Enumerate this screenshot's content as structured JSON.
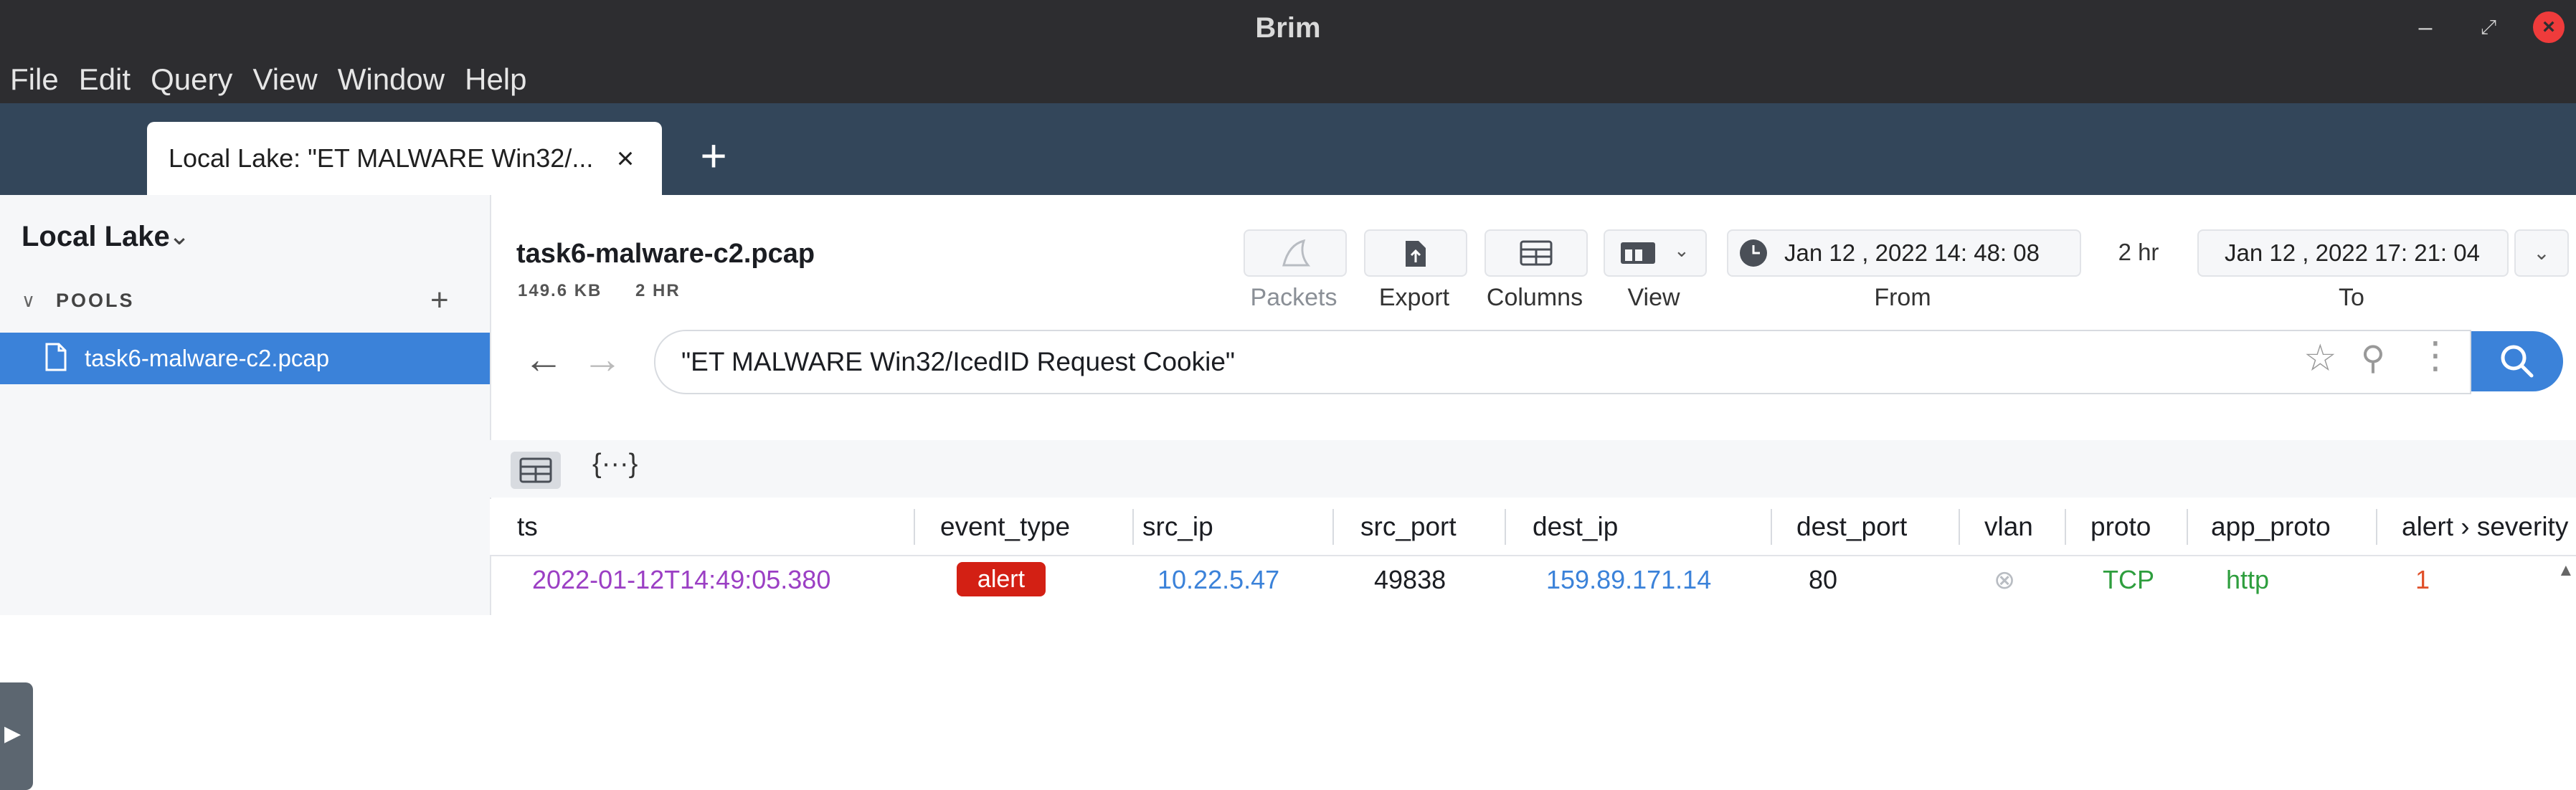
{
  "window": {
    "title": "Brim",
    "controls": {
      "minimize": "–",
      "restore": "⤢",
      "close": "×"
    }
  },
  "menu": [
    "File",
    "Edit",
    "Query",
    "View",
    "Window",
    "Help"
  ],
  "tabs": [
    {
      "label": "Local Lake: \"ET MALWARE Win32/...",
      "close_icon": "×",
      "active": true
    }
  ],
  "tab_add": "+",
  "sidebar": {
    "lake_name": "Local Lake",
    "lake_chevron": "⌄",
    "pools_chevron": "∨",
    "pools_label": "POOLS",
    "pools_add": "+",
    "pools": [
      {
        "name": "task6-malware-c2.pcap",
        "icon": "file-icon",
        "selected": true
      }
    ],
    "handle_icon": "▶"
  },
  "header": {
    "file_name": "task6-malware-c2.pcap",
    "file_size": "149.6 KB",
    "file_span": "2 HR",
    "buttons": {
      "packets": "Packets",
      "export": "Export",
      "columns": "Columns",
      "view": "View"
    },
    "time": {
      "from_value": "Jan  12 , 2022   14: 48: 08",
      "span": "2 hr",
      "to_value": "Jan  12 , 2022   17: 21: 04",
      "from_label": "From",
      "to_label": "To",
      "to_chevron": "⌄"
    }
  },
  "search": {
    "back_icon": "←",
    "forward_icon": "→",
    "query": "\"ET MALWARE Win32/IcedID Request Cookie\"",
    "star_icon": "☆",
    "pin_icon": "⚲",
    "more_icon": "⋮"
  },
  "results": {
    "json_view_icon": "{···}",
    "columns": [
      "ts",
      "event_type",
      "src_ip",
      "src_port",
      "dest_ip",
      "dest_port",
      "vlan",
      "proto",
      "app_proto",
      "alert › severity"
    ],
    "rows": [
      {
        "ts": "2022-01-12T14:49:05.380",
        "event_type": "alert",
        "src_ip": "10.22.5.47",
        "src_port": "49838",
        "dest_ip": "159.89.171.14",
        "dest_port": "80",
        "vlan": "⊗",
        "proto": "TCP",
        "app_proto": "http",
        "severity": "1"
      }
    ]
  },
  "colors": {
    "titlebar": "#2d2d30",
    "tabbar": "#33465a",
    "accent": "#3b82d9",
    "alert_badge": "#d32014",
    "ts": "#9b3fc4",
    "ip": "#3b82d9",
    "proto": "#2e9e3e",
    "severity": "#e0502a"
  }
}
